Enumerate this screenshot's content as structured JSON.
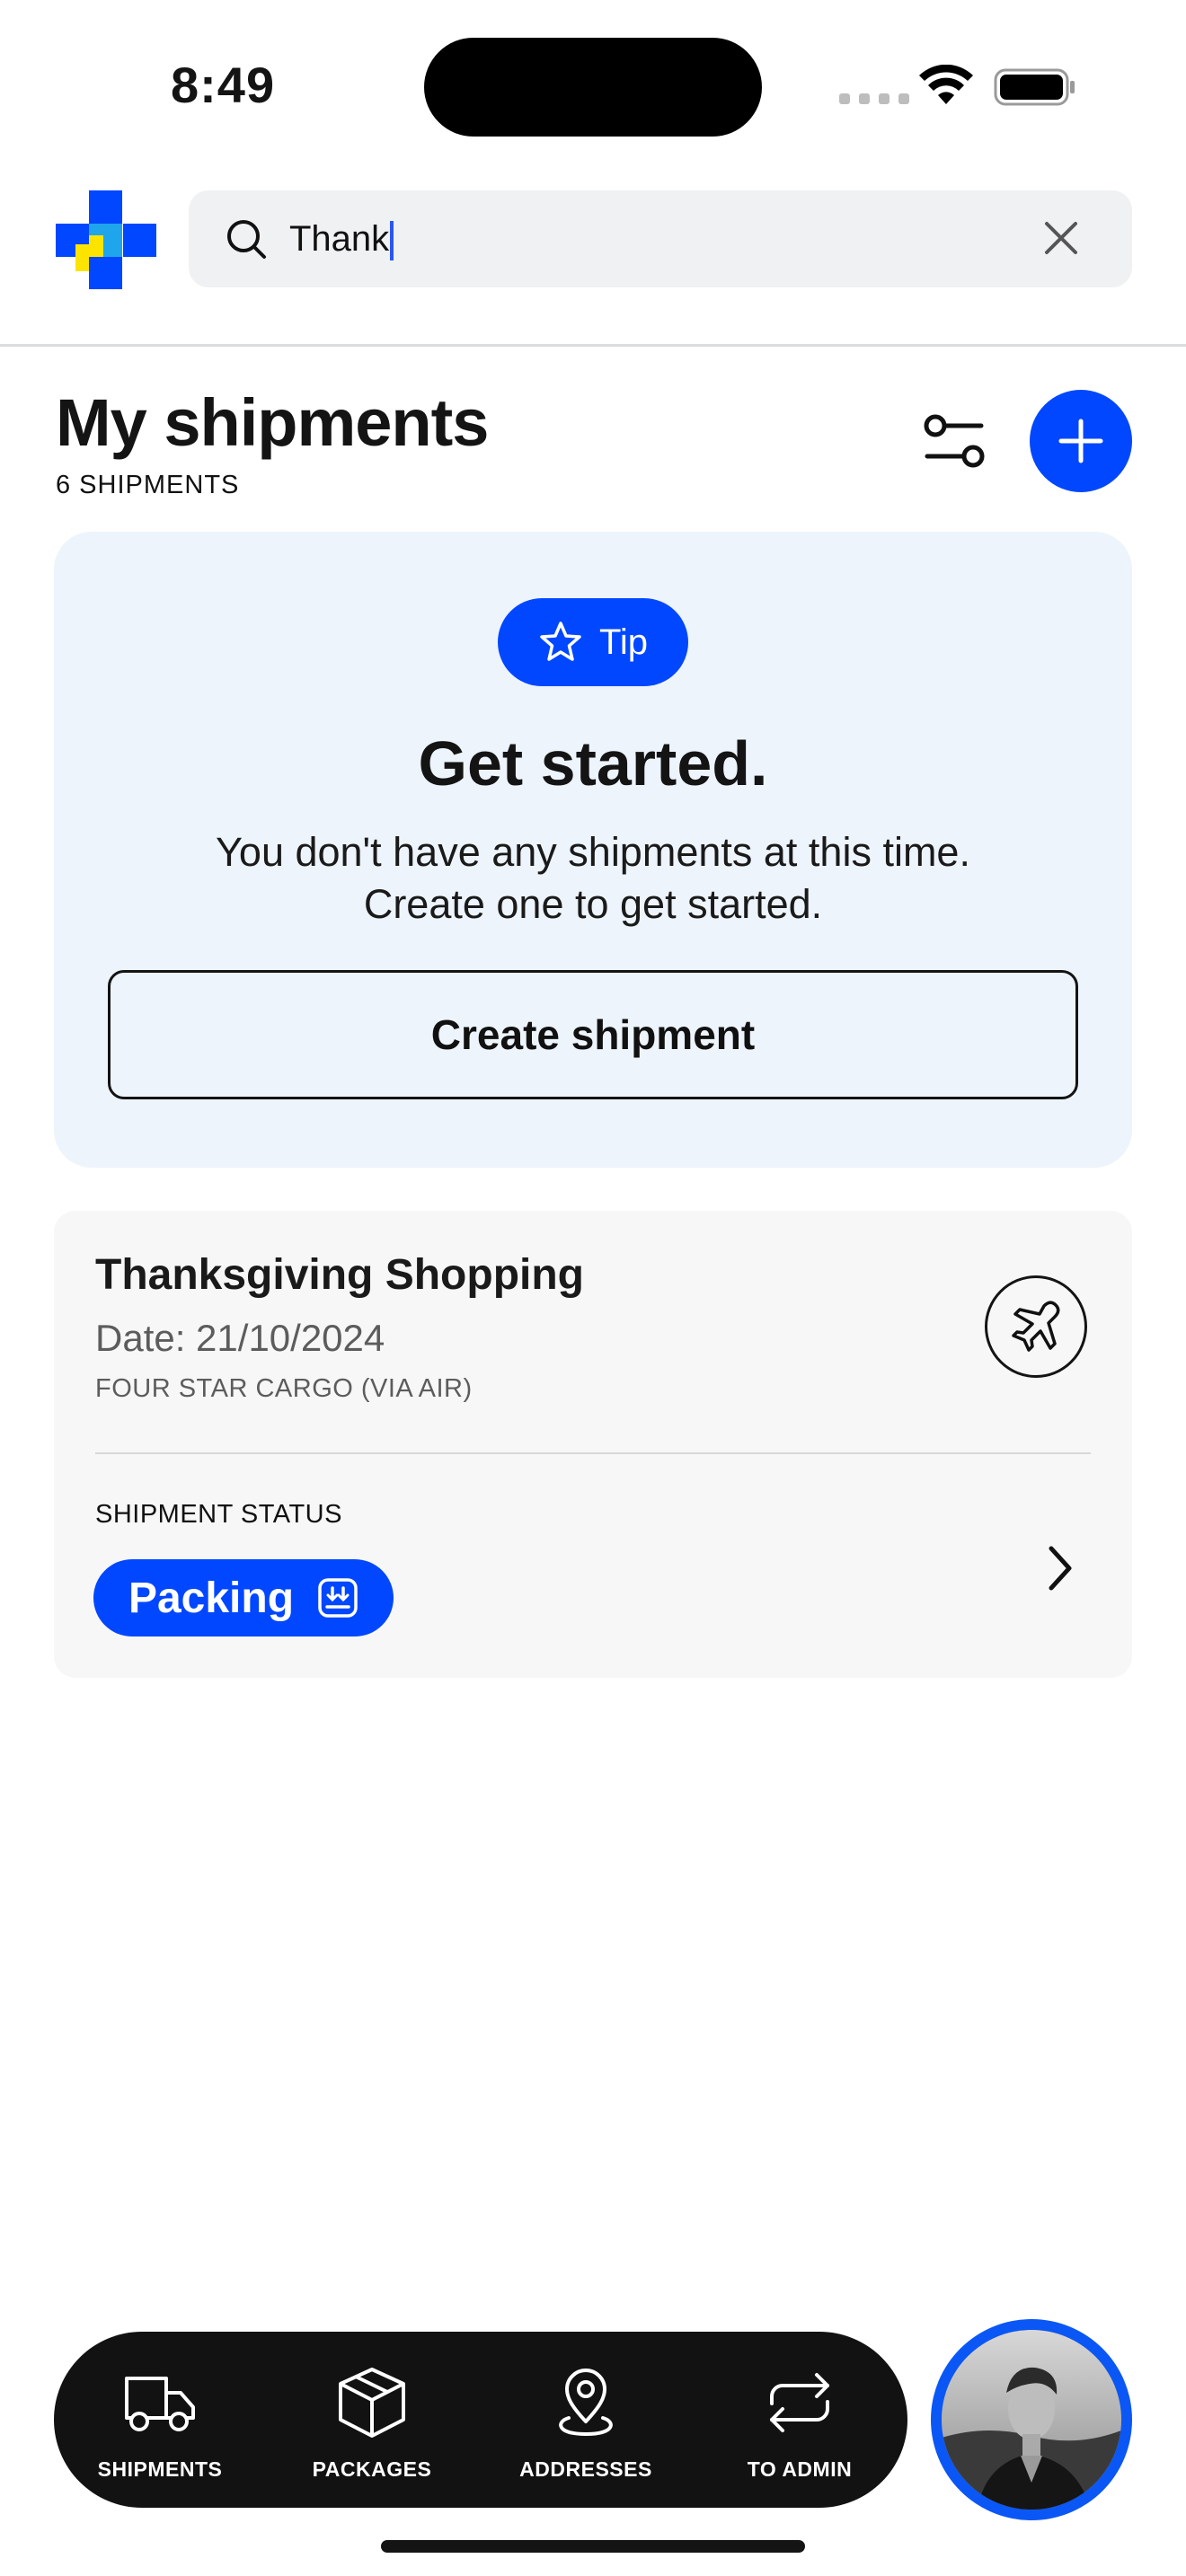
{
  "status_bar": {
    "time": "8:49"
  },
  "search": {
    "value": "Thank"
  },
  "header": {
    "title": "My shipments",
    "count_label": "6 SHIPMENTS"
  },
  "tip": {
    "badge": "Tip",
    "title": "Get started.",
    "text": "You don't have any shipments at this time. Create one to get started.",
    "button": "Create shipment"
  },
  "shipment": {
    "title": "Thanksgiving Shopping",
    "date": "Date: 21/10/2024",
    "carrier": "FOUR STAR CARGO (VIA AIR)",
    "status_label": "SHIPMENT STATUS",
    "status": "Packing"
  },
  "nav": [
    {
      "label": "SHIPMENTS",
      "icon": "truck-icon"
    },
    {
      "label": "PACKAGES",
      "icon": "box-icon"
    },
    {
      "label": "ADDRESSES",
      "icon": "map-pin-icon"
    },
    {
      "label": "TO ADMIN",
      "icon": "swap-arrows-icon"
    }
  ],
  "colors": {
    "accent": "#0047ff",
    "tip_background": "#edf4fc",
    "card_background": "#f7f7f7",
    "nav_background": "#121212"
  }
}
